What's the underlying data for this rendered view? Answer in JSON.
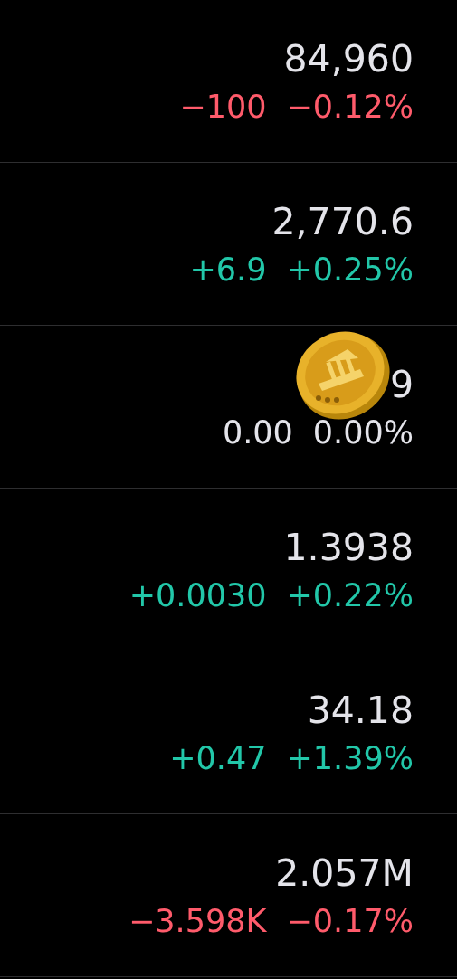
{
  "quotes": [
    {
      "price": "84,960",
      "change": "−100",
      "percent": "−0.12%",
      "color": "#ff5b6b"
    },
    {
      "price": "2,770.6",
      "change": "+6.9",
      "percent": "+0.25%",
      "color": "#22c7a9"
    },
    {
      "price": "9",
      "change": "0.00",
      "percent": "0.00%",
      "color": "#e4e4ea",
      "covered": true
    },
    {
      "price": "1.3938",
      "change": "+0.0030",
      "percent": "+0.22%",
      "color": "#22c7a9"
    },
    {
      "price": "34.18",
      "change": "+0.47",
      "percent": "+1.39%",
      "color": "#22c7a9"
    },
    {
      "price": "2.057M",
      "change": "−3.598K",
      "percent": "−0.17%",
      "color": "#ff5b6b"
    }
  ]
}
